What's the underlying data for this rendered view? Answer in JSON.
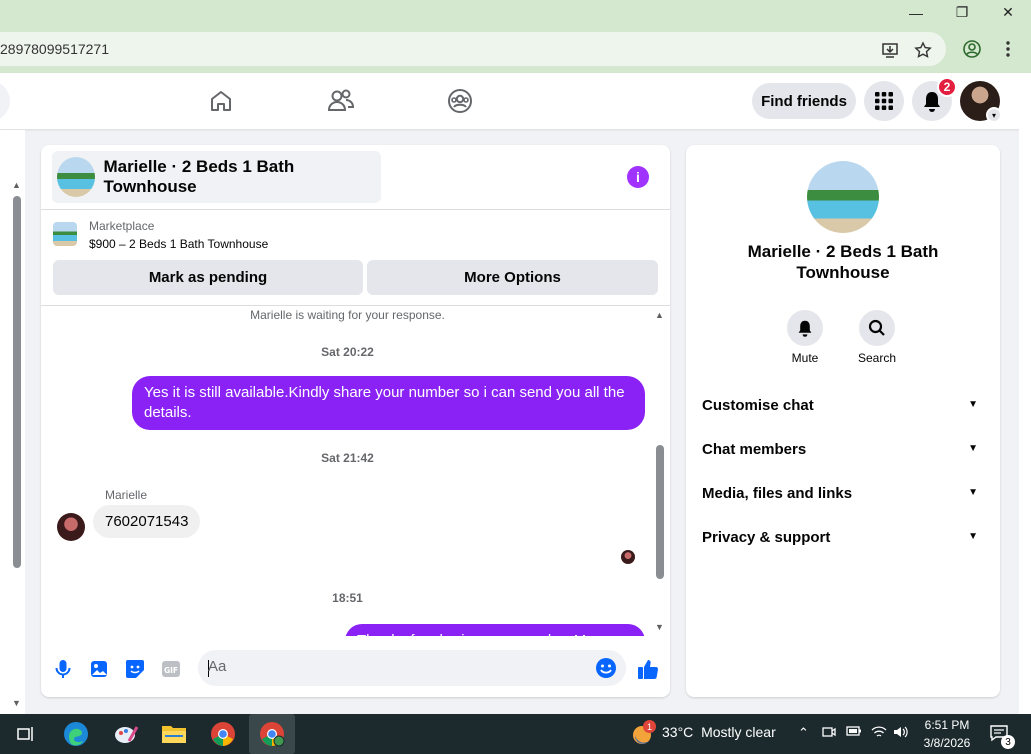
{
  "browser": {
    "url": "28978099517271",
    "window_controls": {
      "minimize": "—",
      "restore": "❐",
      "close": "✕"
    }
  },
  "nav": {
    "find_friends_label": "Find friends",
    "notifications_count": "2"
  },
  "chat": {
    "title": "Marielle · 2 Beds 1 Bath Townhouse",
    "marketplace_label": "Marketplace",
    "listing_price_title": "$900 – 2 Beds 1 Bath Townhouse",
    "mark_pending_label": "Mark as pending",
    "more_options_label": "More Options",
    "system_message": "Marielle is waiting for your response.",
    "messages": [
      {
        "type": "timestamp",
        "text": "Sat 20:22"
      },
      {
        "type": "outgoing",
        "text": "Yes it is still available.Kindly share your number so i can send you all the details."
      },
      {
        "type": "timestamp",
        "text": "Sat 21:42"
      },
      {
        "type": "sender",
        "text": "Marielle"
      },
      {
        "type": "incoming",
        "text": "7602071543"
      },
      {
        "type": "timestamp",
        "text": "18:51"
      },
      {
        "type": "outgoing",
        "text": "Thanks for sharing your number My"
      }
    ],
    "composer_placeholder": "Aa"
  },
  "details": {
    "title": "Marielle · 2 Beds 1 Bath Townhouse",
    "actions": [
      {
        "label": "Mute",
        "icon": "bell-icon"
      },
      {
        "label": "Search",
        "icon": "search-icon"
      }
    ],
    "sections": [
      "Customise chat",
      "Chat members",
      "Media, files and links",
      "Privacy & support"
    ]
  },
  "taskbar": {
    "weather_temp": "33°C",
    "weather_desc": "Mostly clear",
    "weather_badge": "1",
    "time": "6:51 PM",
    "date": "3/8/2026",
    "notification_count": "3"
  },
  "colors": {
    "accent_purple": "#8a22f6",
    "info_purple": "#a033ff",
    "fb_blue": "#0866ff",
    "badge_red": "#e41e3f"
  }
}
